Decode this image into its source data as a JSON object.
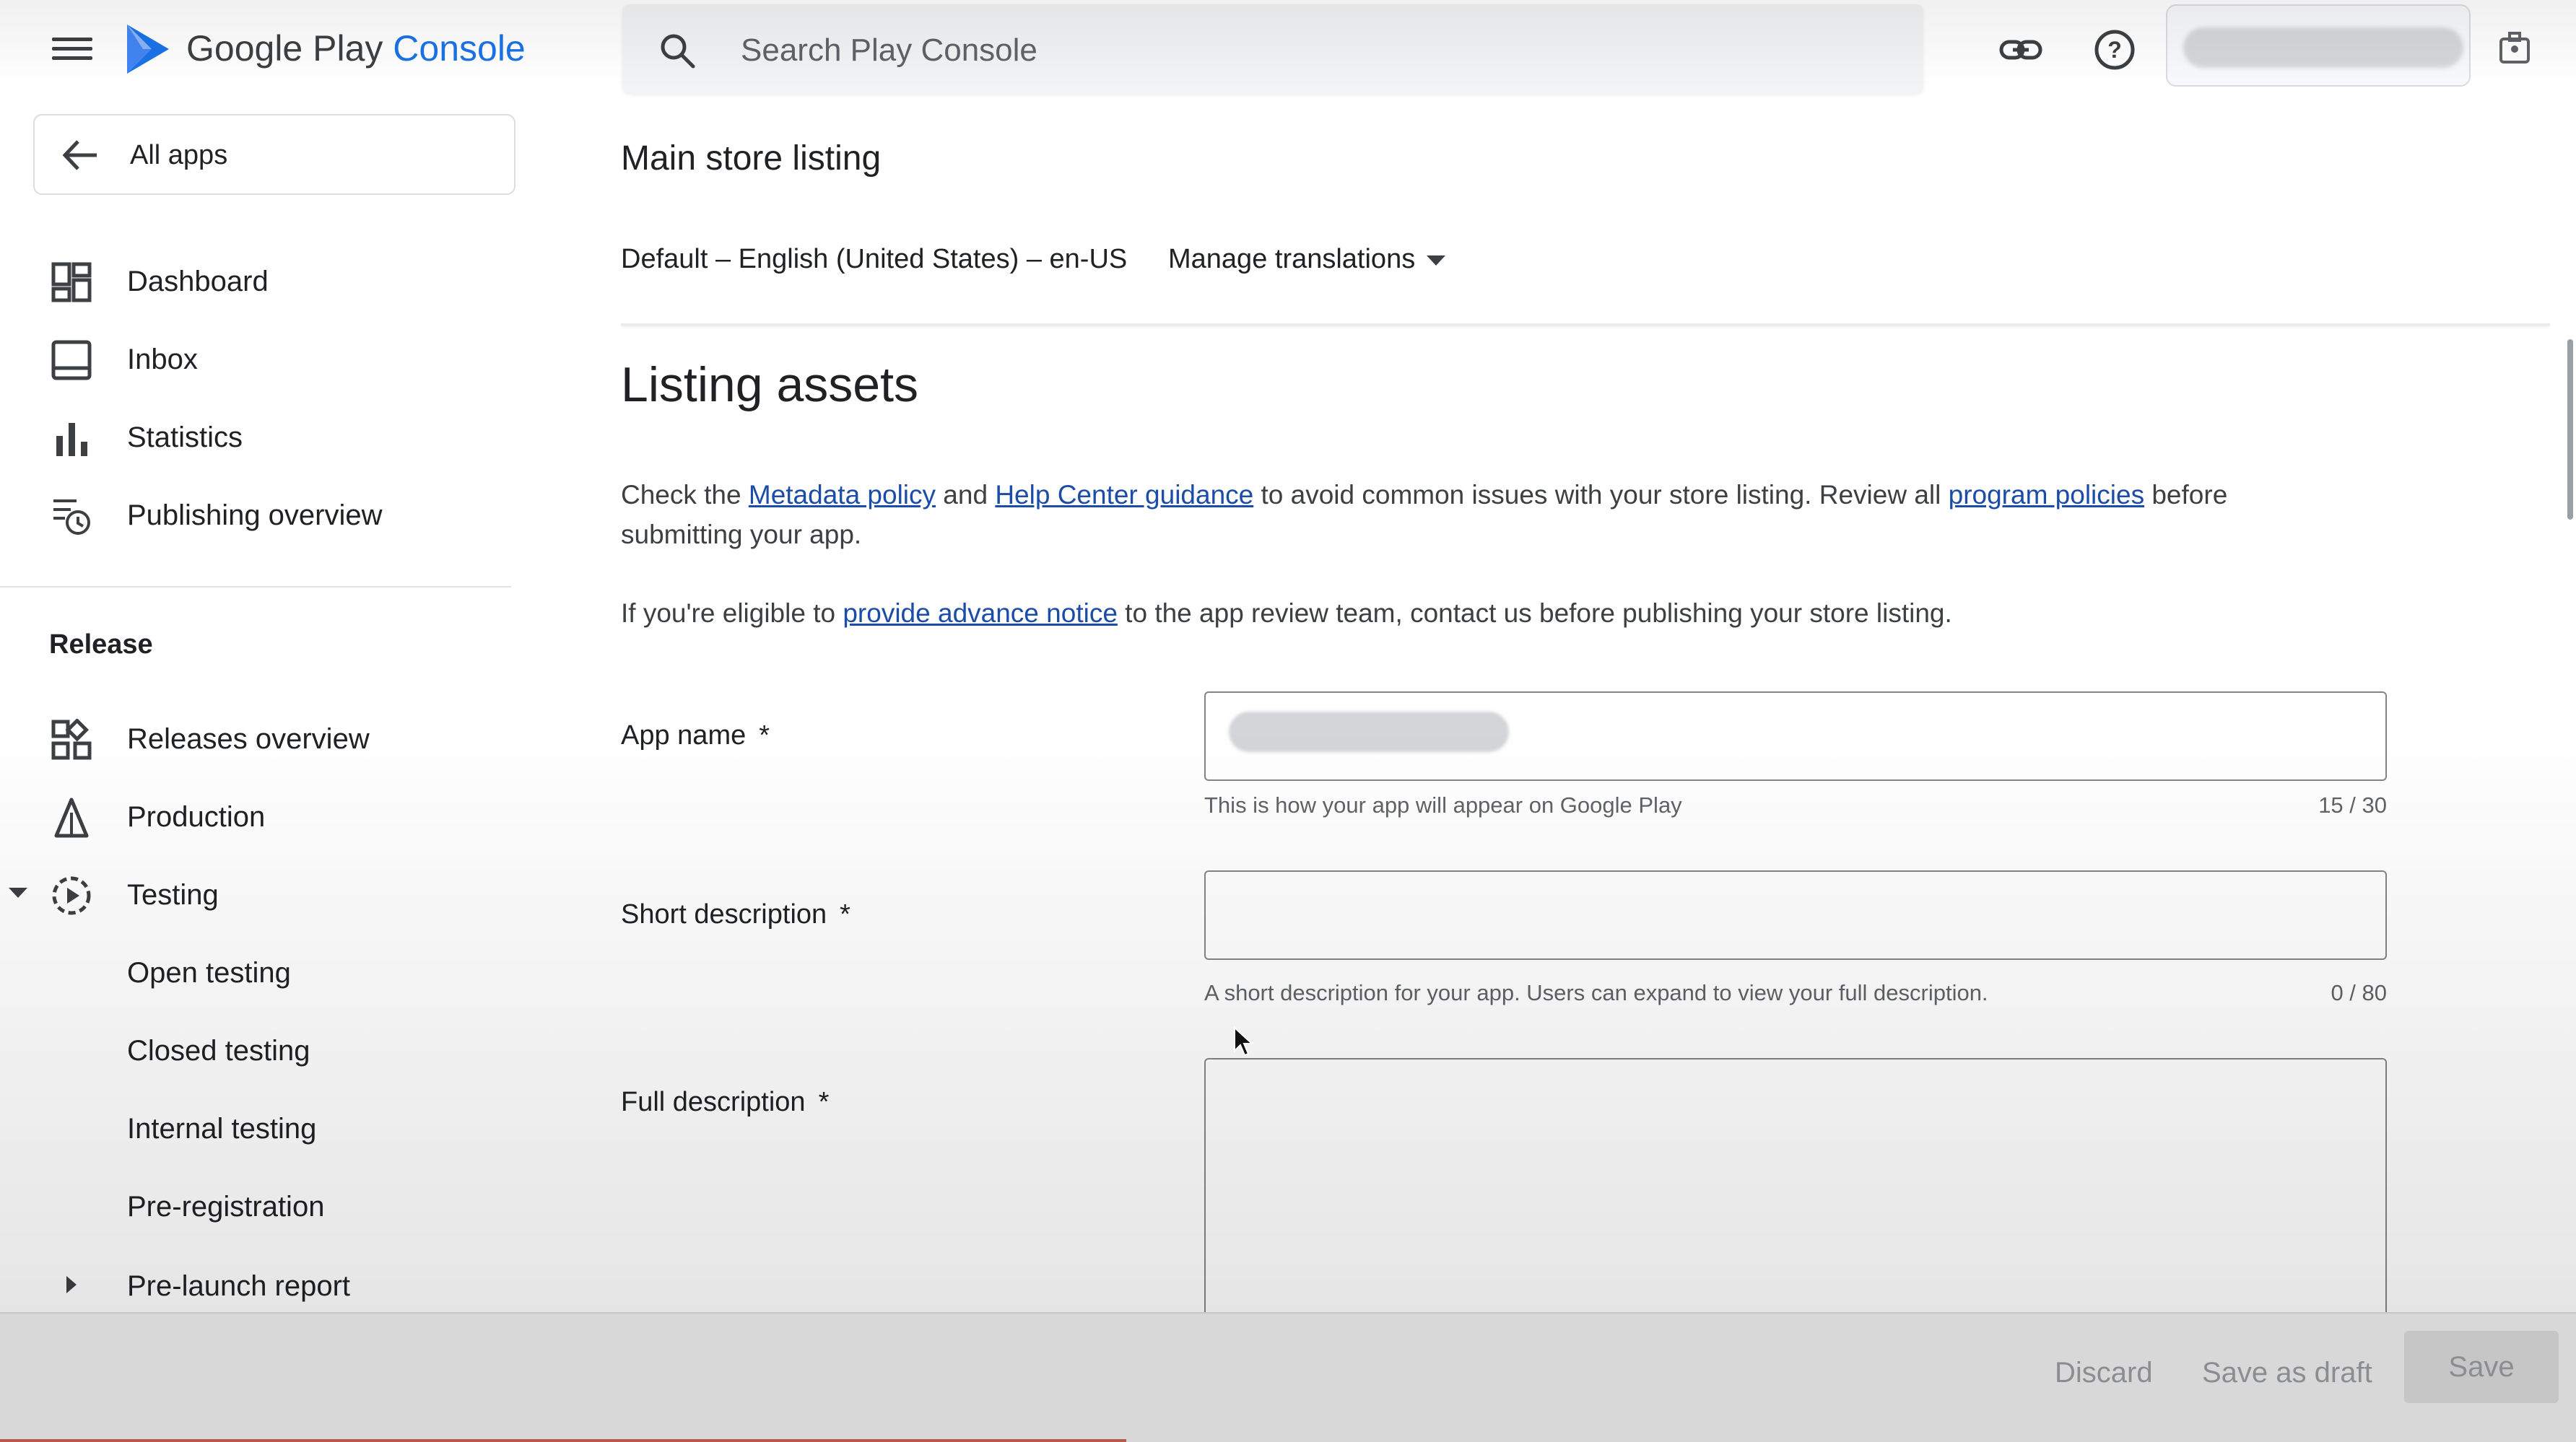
{
  "header": {
    "brand_main": "Google Play",
    "brand_accent": "Console",
    "search_placeholder": "Search Play Console"
  },
  "sidebar": {
    "back_label": "All apps",
    "primary": [
      "Dashboard",
      "Inbox",
      "Statistics",
      "Publishing overview"
    ],
    "section_label": "Release",
    "release": [
      "Releases overview",
      "Production",
      "Testing"
    ],
    "testing_sub": [
      "Open testing",
      "Closed testing",
      "Internal testing",
      "Pre-registration"
    ],
    "pre_launch": "Pre-launch report"
  },
  "main": {
    "title": "Main store listing",
    "locale": "Default – English (United States) – en-US",
    "manage_translations": "Manage translations",
    "section_title": "Listing assets",
    "para1": {
      "t1": "Check the ",
      "link1": "Metadata policy",
      "t2": " and ",
      "link2": "Help Center guidance",
      "t3": " to avoid common issues with your store listing. Review all ",
      "link3": "program policies",
      "t4": " before submitting your app."
    },
    "para2": {
      "t1": "If you're eligible to ",
      "link1": "provide advance notice",
      "t2": " to the app review team, contact us before publishing your store listing."
    },
    "fields": {
      "app_name": {
        "label": "App name",
        "required": "*",
        "helper": "This is how your app will appear on Google Play",
        "counter": "15 / 30"
      },
      "short_description": {
        "label": "Short description",
        "required": "*",
        "helper": "A short description for your app. Users can expand to view your full description.",
        "counter": "0 / 80"
      },
      "full_description": {
        "label": "Full description",
        "required": "*"
      }
    }
  },
  "footer": {
    "discard": "Discard",
    "save_draft": "Save as draft",
    "save": "Save"
  },
  "colors": {
    "brand_blue": "#1a73e8",
    "link": "#1a4ca8",
    "text": "#202124",
    "muted": "#5f6368"
  }
}
